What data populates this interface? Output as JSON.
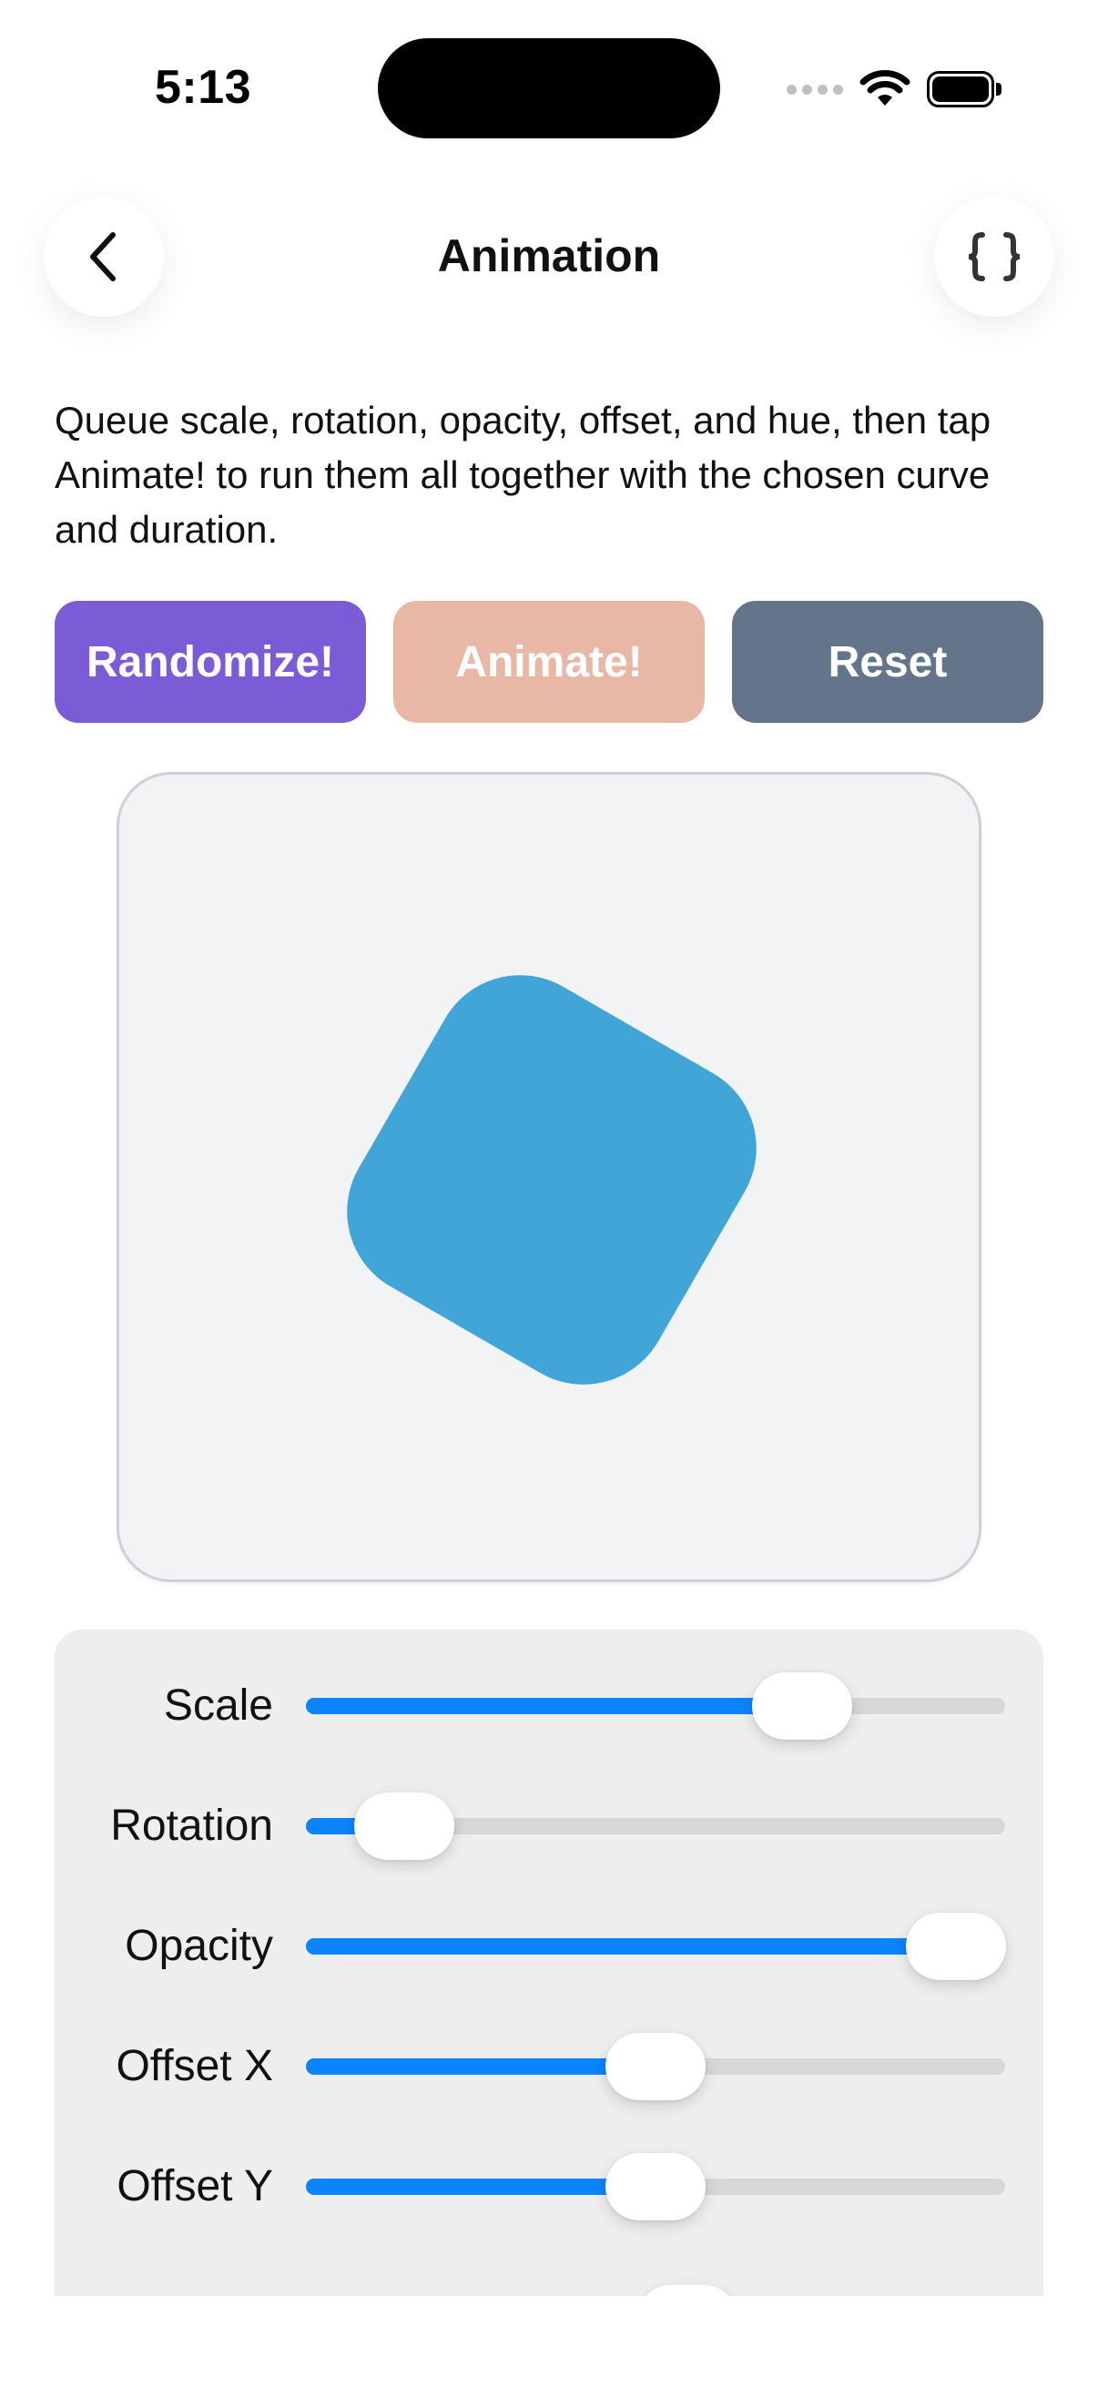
{
  "status_bar": {
    "time": "5:13"
  },
  "nav": {
    "title": "Animation",
    "back_icon": "chevron-left-icon",
    "code_icon": "curly-braces-icon"
  },
  "description": "Queue scale, rotation, opacity, offset, and hue, then tap Animate! to run them all together with the chosen curve and duration.",
  "buttons": {
    "randomize_label": "Randomize!",
    "animate_label": "Animate!",
    "reset_label": "Reset"
  },
  "colors": {
    "accent_blue": "#0a84ff",
    "randomize": "#7b5bd6",
    "animate": "#e8b7a6",
    "reset": "#64748b",
    "shape": "#42a5d8"
  },
  "stage": {
    "shape_rotation_deg": 30
  },
  "sliders": [
    {
      "label": "Scale",
      "value": 0.71
    },
    {
      "label": "Rotation",
      "value": 0.14
    },
    {
      "label": "Opacity",
      "value": 0.93
    },
    {
      "label": "Offset X",
      "value": 0.5
    },
    {
      "label": "Offset Y",
      "value": 0.5
    }
  ]
}
